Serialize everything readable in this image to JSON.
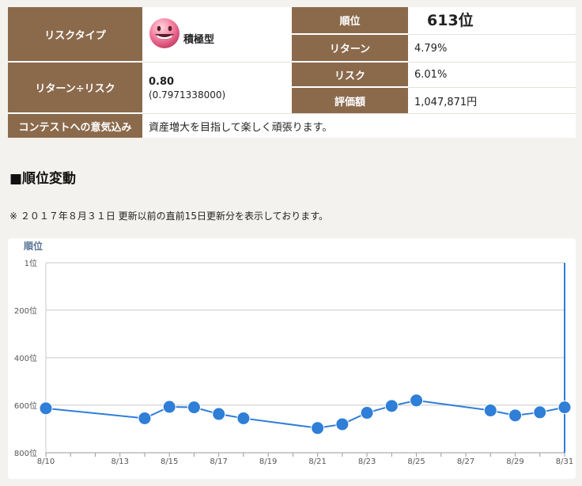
{
  "info": {
    "risk_type_label": "リスクタイプ",
    "risk_type_value": "積極型",
    "smiley_icon": "smiley-face-icon",
    "rank_label": "順位",
    "rank_value": "613位",
    "return_label": "リターン",
    "return_value": "4.79%",
    "ratio_label": "リターン÷リスク",
    "ratio_value": "0.80",
    "ratio_exact": "(0.7971338000)",
    "risk_label": "リスク",
    "risk_value": "6.01%",
    "valuation_label": "評価額",
    "valuation_value": "1,047,871円",
    "contest_label": "コンテストへの意気込み",
    "contest_value": "資産増大を目指して楽しく頑張ります。"
  },
  "section": {
    "title": "■順位変動",
    "note": "※ ２０１７年８月３１日 更新以前の直前15日更新分を表示しております。"
  },
  "colors": {
    "header_bg": "#8b6a4c",
    "line": "#2f7ed8",
    "grid": "#c8c8c8"
  },
  "chart_data": {
    "type": "line",
    "ylabel": "順位",
    "y_inverted": true,
    "ylim": [
      1,
      800
    ],
    "y_ticks": [
      {
        "value": 1,
        "label": "1位"
      },
      {
        "value": 200,
        "label": "200位"
      },
      {
        "value": 400,
        "label": "400位"
      },
      {
        "value": 600,
        "label": "600位"
      },
      {
        "value": 800,
        "label": "800位"
      }
    ],
    "x_ticks": [
      "8/10",
      "8/13",
      "8/15",
      "8/17",
      "8/19",
      "8/21",
      "8/23",
      "8/25",
      "8/27",
      "8/29",
      "8/31"
    ],
    "x_day_range": [
      10,
      31
    ],
    "points": [
      {
        "x": "8/10",
        "y": 613
      },
      {
        "x": "8/14",
        "y": 655
      },
      {
        "x": "8/15",
        "y": 607
      },
      {
        "x": "8/16",
        "y": 609
      },
      {
        "x": "8/17",
        "y": 637
      },
      {
        "x": "8/18",
        "y": 655
      },
      {
        "x": "8/21",
        "y": 696
      },
      {
        "x": "8/22",
        "y": 680
      },
      {
        "x": "8/23",
        "y": 632
      },
      {
        "x": "8/24",
        "y": 603
      },
      {
        "x": "8/25",
        "y": 580
      },
      {
        "x": "8/28",
        "y": 622
      },
      {
        "x": "8/29",
        "y": 643
      },
      {
        "x": "8/30",
        "y": 630
      },
      {
        "x": "8/31",
        "y": 609
      }
    ],
    "grid": true,
    "legend": false
  }
}
